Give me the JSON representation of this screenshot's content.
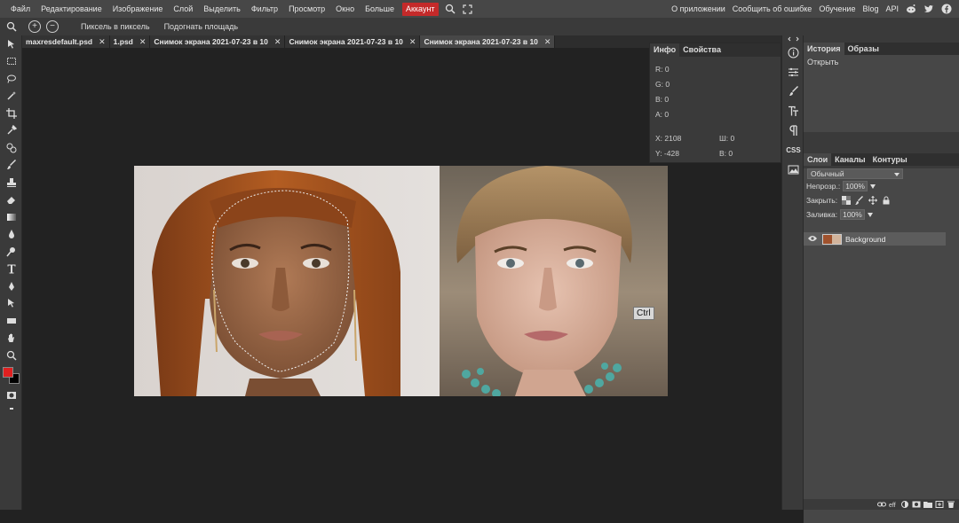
{
  "menu": {
    "items": [
      "Файл",
      "Редактирование",
      "Изображение",
      "Слой",
      "Выделить",
      "Фильтр",
      "Просмотр",
      "Окно",
      "Больше"
    ],
    "account": "Аккаунт",
    "right": [
      "О приложении",
      "Сообщить об ошибке",
      "Обучение",
      "Blog",
      "API"
    ]
  },
  "options": {
    "pixel": "Пиксель в пиксель",
    "fit": "Подогнать площадь"
  },
  "tabs": [
    {
      "label": "maxresdefault.psd"
    },
    {
      "label": "1.psd"
    },
    {
      "label": "Снимок экрана 2021-07-23 в 10"
    },
    {
      "label": "Снимок экрана 2021-07-23 в 10"
    },
    {
      "label": "Снимок экрана 2021-07-23 в 10"
    }
  ],
  "info": {
    "tab_info": "Инфо",
    "tab_props": "Свойства",
    "r": "R: 0",
    "g": "G: 0",
    "b": "B: 0",
    "a": "A: 0",
    "x": "X: 2108",
    "y": "Y: -428",
    "w": "Ш: 0",
    "h": "В: 0"
  },
  "canvas": {
    "ctrl_badge": "Ctrl"
  },
  "minicol": {
    "css_label": "CSS"
  },
  "history": {
    "tab_history": "История",
    "tab_images": "Образы",
    "items": [
      "Открыть"
    ]
  },
  "layers": {
    "tab_layers": "Слои",
    "tab_channels": "Каналы",
    "tab_paths": "Контуры",
    "blend_mode": "Обычный",
    "opacity_label": "Непрозр.:",
    "opacity_value": "100%",
    "lock_label": "Закрыть:",
    "fill_label": "Заливка:",
    "fill_value": "100%",
    "layer_name": "Background"
  },
  "colors": {
    "accent": "#c42a2a",
    "foreground": "#e02020",
    "background": "#000000"
  }
}
